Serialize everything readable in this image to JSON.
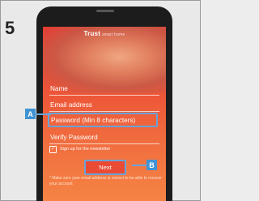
{
  "step_number": "5",
  "app": {
    "brand": "Trust",
    "brand_tag": "smart home"
  },
  "form": {
    "name_label": "Name",
    "email_label": "Email address",
    "password_label": "Password (Min 8 characters)",
    "verify_password_label": "Verify Password",
    "newsletter_label": "Sign up for the newsletter",
    "newsletter_checked": true,
    "next_label": "Next",
    "notice": "* Make sure your email address is correct to be able to recover your account"
  },
  "callouts": {
    "a": "A",
    "b": "B"
  },
  "colors": {
    "accent_blue": "#3f94d4",
    "screen_red": "#e63a32",
    "screen_orange": "#f58444"
  }
}
